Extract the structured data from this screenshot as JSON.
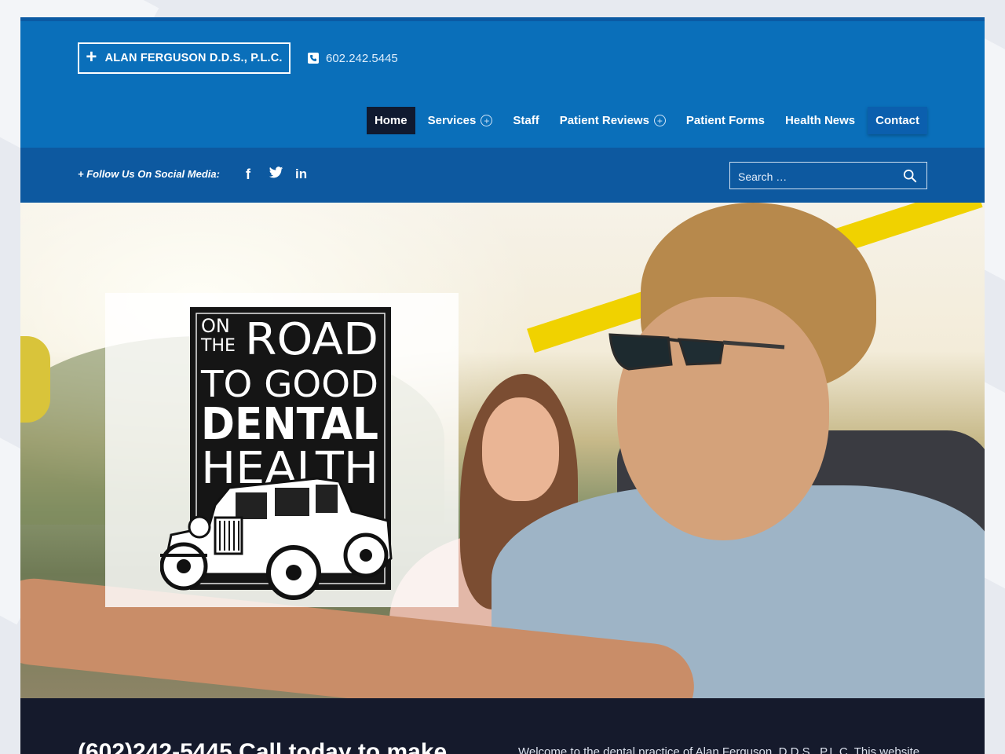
{
  "header": {
    "practice_name": "ALAN FERGUSON D.D.S., P.L.C.",
    "phone": "602.242.5445"
  },
  "nav": {
    "items": [
      {
        "label": "Home",
        "active": true,
        "has_submenu": false
      },
      {
        "label": "Services",
        "active": false,
        "has_submenu": true
      },
      {
        "label": "Staff",
        "active": false,
        "has_submenu": false
      },
      {
        "label": "Patient Reviews",
        "active": false,
        "has_submenu": true
      },
      {
        "label": "Patient Forms",
        "active": false,
        "has_submenu": false
      },
      {
        "label": "Health News",
        "active": false,
        "has_submenu": false
      },
      {
        "label": "Contact",
        "active": false,
        "has_submenu": false
      }
    ]
  },
  "social": {
    "follow_label": "+ Follow Us On Social Media:",
    "icons": [
      "facebook-icon",
      "twitter-icon",
      "linkedin-icon"
    ],
    "facebook_glyph": "f",
    "linkedin_glyph": "in"
  },
  "search": {
    "placeholder": "Search …"
  },
  "hero": {
    "logo_text": [
      "ON",
      "THE",
      "ROAD",
      "TO GOOD",
      "DENTAL",
      "HEALTH"
    ]
  },
  "info": {
    "call_text": "(602)242-5445 Call today to make",
    "welcome_text": "Welcome to the dental practice of Alan Ferguson, D.D.S., P.L.C. This website"
  },
  "colors": {
    "header_blue": "#0a6fba",
    "social_blue": "#0d59a0",
    "nav_active": "#101a30",
    "footer_dark": "#151a2c"
  }
}
